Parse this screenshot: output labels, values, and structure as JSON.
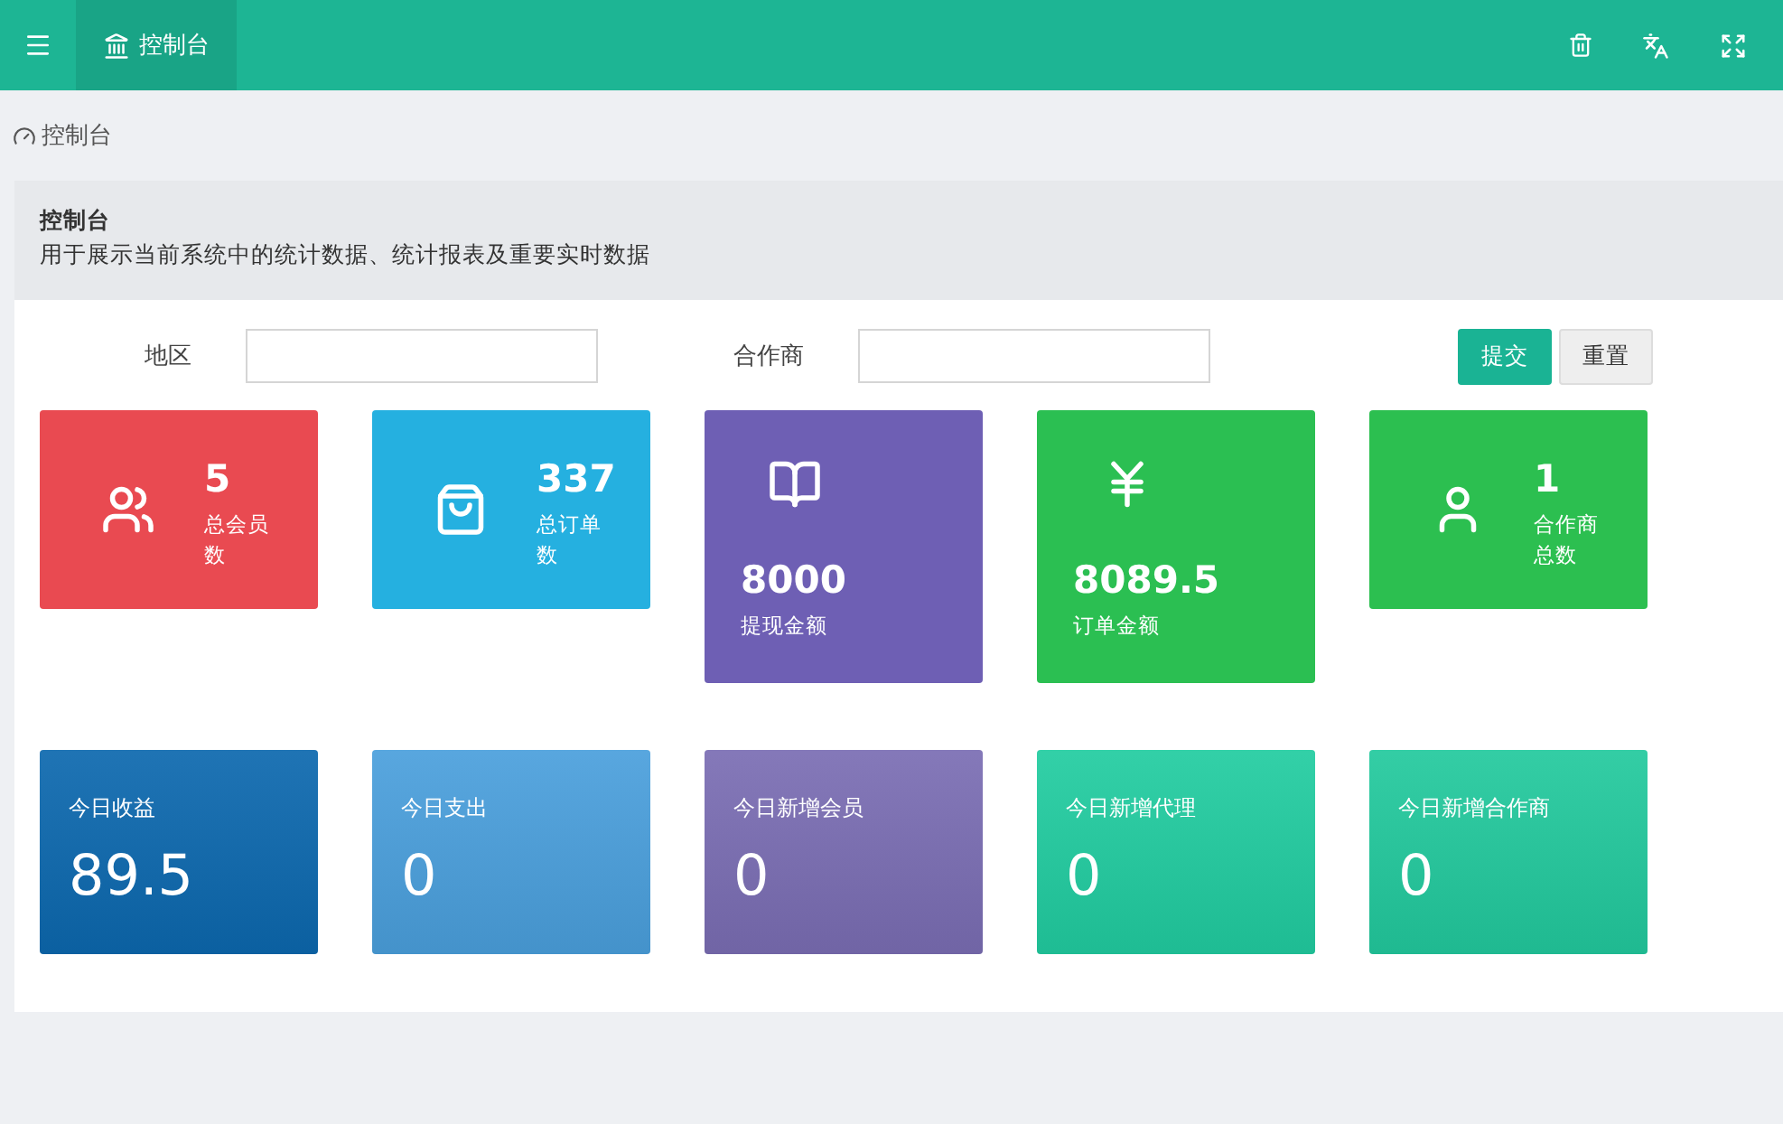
{
  "topbar": {
    "tabs": [
      {
        "label": "控制台",
        "selected": true
      }
    ]
  },
  "breadcrumb": "控制台",
  "panel": {
    "title": "控制台",
    "description": "用于展示当前系统中的统计数据、统计报表及重要实时数据"
  },
  "filters": [
    {
      "label": "地区"
    },
    {
      "label": "合作商"
    }
  ],
  "buttons": [
    {
      "label": "提交",
      "kind": "primary"
    },
    {
      "label": "重置",
      "kind": "default"
    }
  ],
  "stats": [
    {
      "kind": "inline",
      "value": "5",
      "label": "总会员数",
      "color": "#e94a51"
    },
    {
      "kind": "inline",
      "value": "337",
      "label": "总订单数",
      "color": "#25b0e0"
    },
    {
      "kind": "stacked",
      "value": "8000",
      "label": "提现金额",
      "color": "#6e5fb4"
    },
    {
      "kind": "stacked",
      "value": "8089.5",
      "label": "订单金额",
      "color": "#2bbf52"
    },
    {
      "kind": "inline",
      "value": "1",
      "label": "合作商总数",
      "color": "#2cbf50"
    }
  ],
  "today": [
    {
      "label": "今日收益",
      "value": "89.5",
      "color": "#0c68ae"
    },
    {
      "label": "今日支出",
      "value": "0",
      "color": "#4a9fdc"
    },
    {
      "label": "今日新增会员",
      "value": "0",
      "color": "#7a6db3"
    },
    {
      "label": "今日新增代理",
      "value": "0",
      "color": "#21cca0"
    },
    {
      "label": "今日新增合作商",
      "value": "0",
      "color": "#22c99d"
    }
  ]
}
